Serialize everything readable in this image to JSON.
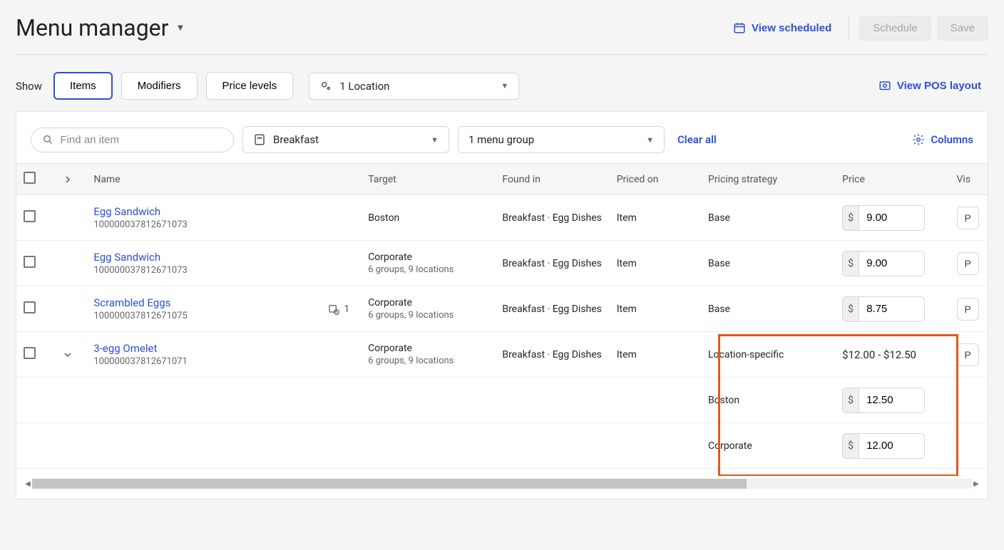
{
  "header": {
    "title": "Menu manager",
    "view_scheduled": "View scheduled",
    "schedule": "Schedule",
    "save": "Save"
  },
  "toolbar": {
    "show_label": "Show",
    "tabs": {
      "items": "Items",
      "modifiers": "Modifiers",
      "price_levels": "Price levels"
    },
    "location_filter": "1 Location",
    "view_pos": "View POS layout"
  },
  "filters": {
    "search_placeholder": "Find an item",
    "menu_filter": "Breakfast",
    "group_filter": "1 menu group",
    "clear": "Clear all",
    "columns": "Columns"
  },
  "columns": {
    "name": "Name",
    "target": "Target",
    "found": "Found in",
    "priced": "Priced on",
    "strategy": "Pricing strategy",
    "price": "Price",
    "visibility": "Vis"
  },
  "rows": [
    {
      "name": "Egg Sandwich",
      "id": "100000037812671073",
      "target": "Boston",
      "target_sub": "",
      "found": "Breakfast · Egg Dishes",
      "priced": "Item",
      "strategy": "Base",
      "price": "9.00",
      "badge": "",
      "expand": "none",
      "price_mode": "input",
      "vis": "P"
    },
    {
      "name": "Egg Sandwich",
      "id": "100000037812671073",
      "target": "Corporate",
      "target_sub": "6 groups, 9 locations",
      "found": "Breakfast · Egg Dishes",
      "priced": "Item",
      "strategy": "Base",
      "price": "9.00",
      "badge": "",
      "expand": "none",
      "price_mode": "input",
      "vis": "P"
    },
    {
      "name": "Scrambled Eggs",
      "id": "100000037812671075",
      "target": "Corporate",
      "target_sub": "6 groups, 9 locations",
      "found": "Breakfast · Egg Dishes",
      "priced": "Item",
      "strategy": "Base",
      "price": "8.75",
      "badge": "1",
      "expand": "none",
      "price_mode": "input",
      "vis": "P"
    },
    {
      "name": "3-egg Omelet",
      "id": "100000037812671071",
      "target": "Corporate",
      "target_sub": "6 groups, 9 locations",
      "found": "Breakfast · Egg Dishes",
      "priced": "Item",
      "strategy": "Location-specific",
      "price": "$12.00 - $12.50",
      "badge": "",
      "expand": "open",
      "price_mode": "range",
      "vis": "P"
    }
  ],
  "sub_rows": [
    {
      "label": "Boston",
      "price": "12.50"
    },
    {
      "label": "Corporate",
      "price": "12.00"
    }
  ],
  "currency": "$"
}
